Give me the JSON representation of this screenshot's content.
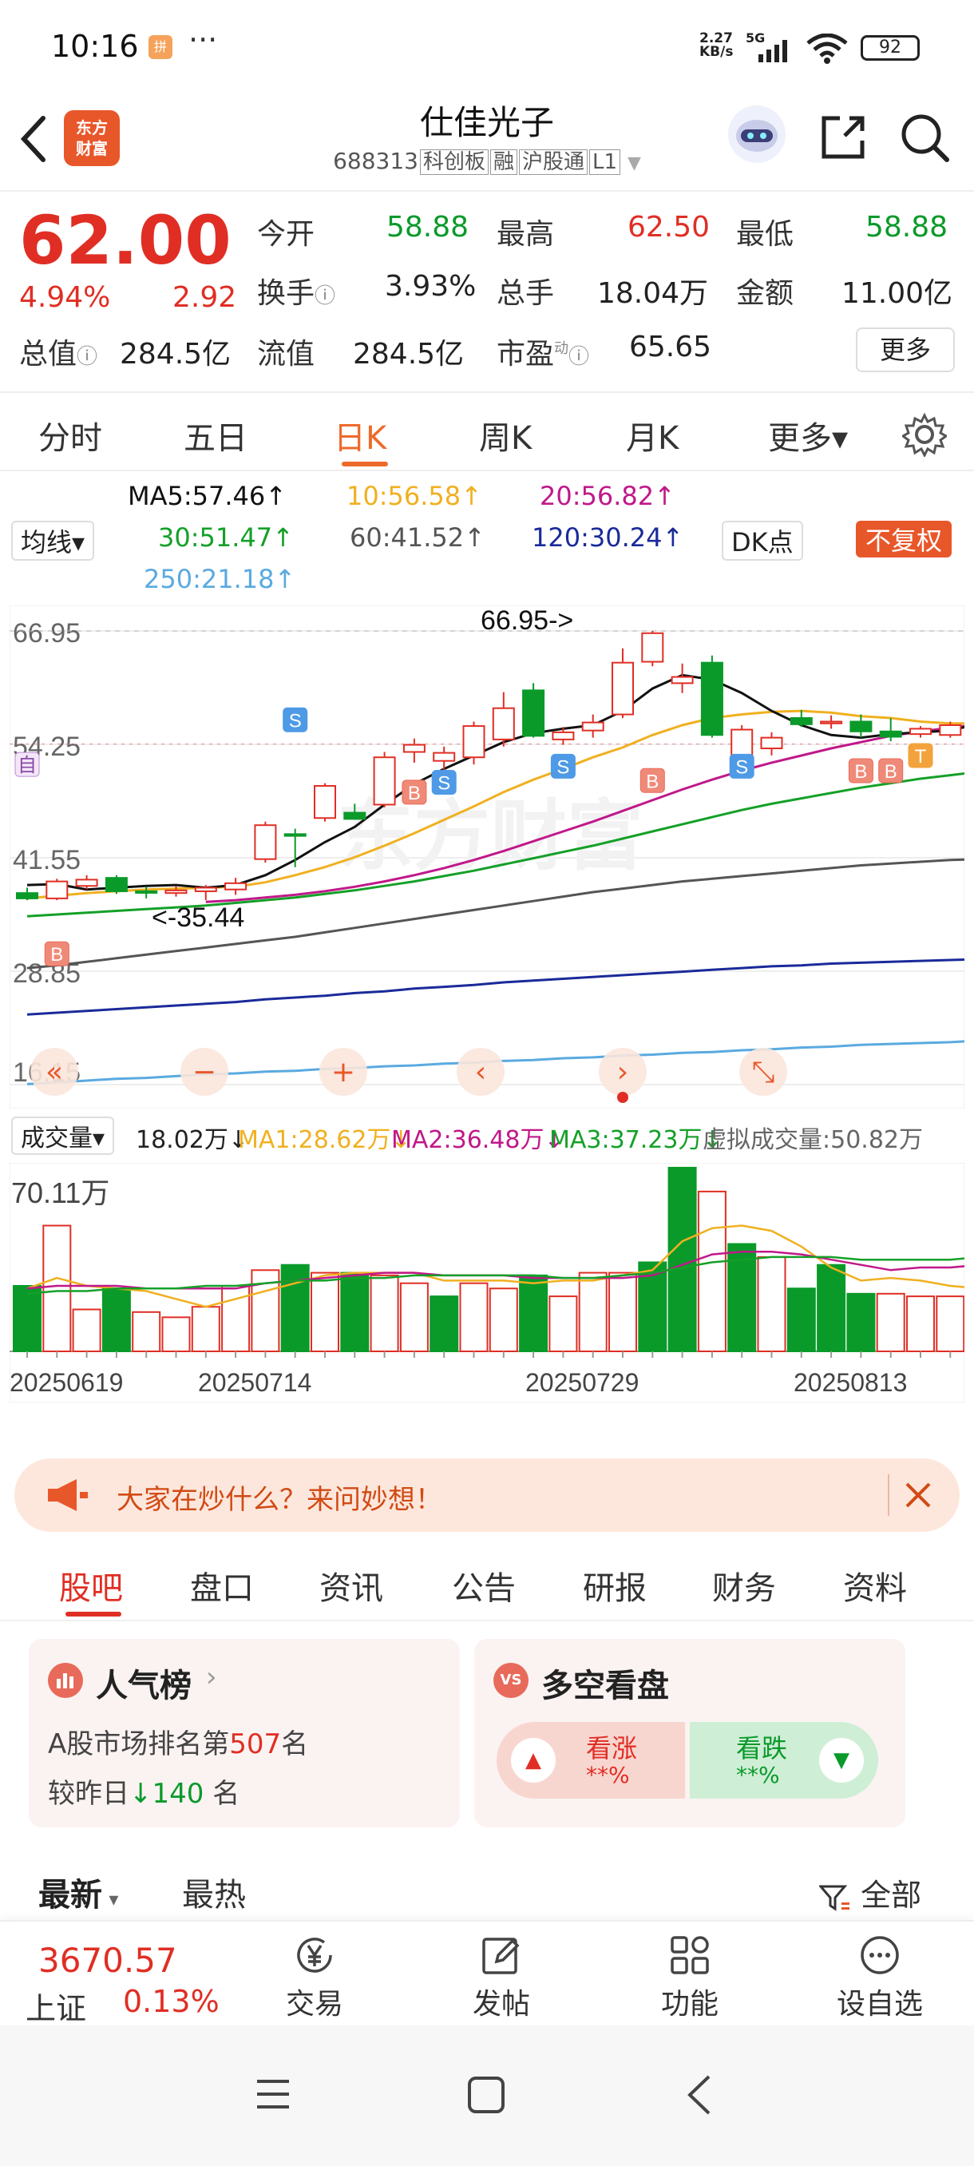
{
  "status_bar": {
    "time": "10:16",
    "notification_badge": "拼",
    "more_dots": "···",
    "net_speed": "2.27",
    "net_unit": "KB/s",
    "signal": "5G",
    "battery": "92"
  },
  "header": {
    "logo_text": "东方财富",
    "stock_name": "仕佳光子",
    "stock_code": "688313",
    "tags": [
      "科创板",
      "融",
      "沪股通",
      "L1"
    ]
  },
  "quote": {
    "price": "62.00",
    "change_pct": "4.94%",
    "change_amt": "2.92",
    "open_label": "今开",
    "open": "58.88",
    "high_label": "最高",
    "high": "62.50",
    "low_label": "最低",
    "low": "58.88",
    "turnover_label": "换手",
    "turnover": "3.93%",
    "volume_label": "总手",
    "volume": "18.04万",
    "amount_label": "金额",
    "amount": "11.00亿",
    "total_cap_label": "总值",
    "total_cap": "284.5亿",
    "float_cap_label": "流值",
    "float_cap": "284.5亿",
    "pe_label": "市盈",
    "pe_sup": "动",
    "pe": "65.65",
    "more_label": "更多"
  },
  "period_tabs": {
    "items": [
      "分时",
      "五日",
      "日K",
      "周K",
      "月K",
      "更多▾"
    ],
    "active": "日K"
  },
  "ma_legend": {
    "ma5": "MA5:57.46↑",
    "ma10": "10:56.58↑",
    "ma20": "20:56.82↑",
    "ma30": "30:51.47↑",
    "ma60": "60:41.52↑",
    "ma120": "120:30.24↑",
    "ma250": "250:21.18↑",
    "selector": "均线▾",
    "dk_label": "DK点",
    "rights_label": "不复权",
    "colors": {
      "ma5": "#111111",
      "ma10": "#f0b020",
      "ma20": "#c0188a",
      "ma30": "#14a028",
      "ma60": "#555555",
      "ma120": "#1a2a9a",
      "ma250": "#5aaae0"
    }
  },
  "kline": {
    "y_ticks": [
      "66.95",
      "54.25",
      "41.55",
      "28.85",
      "16.15"
    ],
    "ymax": 66.95,
    "ymin": 16.15,
    "max_annotation": "66.95->",
    "min_annotation": "<-35.44",
    "ref_price": 59.08,
    "watermark": "东方财富",
    "up_color": "#e02e24",
    "down_color": "#0a9a2a",
    "candles": [
      [
        37.6,
        38.2,
        36.8,
        37.0
      ],
      [
        37.0,
        39.2,
        36.8,
        38.9
      ],
      [
        38.4,
        39.6,
        38.0,
        39.1
      ],
      [
        39.3,
        39.6,
        37.5,
        37.8
      ],
      [
        37.8,
        38.3,
        37.0,
        37.7
      ],
      [
        37.6,
        38.4,
        37.2,
        37.9
      ],
      [
        37.8,
        38.5,
        36.8,
        38.2
      ],
      [
        38.0,
        39.3,
        37.4,
        38.7
      ],
      [
        41.4,
        45.6,
        41.0,
        45.2
      ],
      [
        44.2,
        44.8,
        40.5,
        44.0
      ],
      [
        46.0,
        49.9,
        45.6,
        49.6
      ],
      [
        46.6,
        47.6,
        45.8,
        45.9
      ],
      [
        47.5,
        53.4,
        47.2,
        52.8
      ],
      [
        53.4,
        54.9,
        52.2,
        54.2
      ],
      [
        52.4,
        54.0,
        51.4,
        53.3
      ],
      [
        52.8,
        56.8,
        52.0,
        56.3
      ],
      [
        54.8,
        60.1,
        54.0,
        58.3
      ],
      [
        60.3,
        61.1,
        55.0,
        55.2
      ],
      [
        54.8,
        56.2,
        54.2,
        55.6
      ],
      [
        55.8,
        57.6,
        55.0,
        56.7
      ],
      [
        57.6,
        65.0,
        57.2,
        63.4
      ],
      [
        63.5,
        66.95,
        63.0,
        66.7
      ],
      [
        61.1,
        63.3,
        60.0,
        61.8
      ],
      [
        63.4,
        64.2,
        55.0,
        55.3
      ],
      [
        52.8,
        56.4,
        52.0,
        55.9
      ],
      [
        53.8,
        55.6,
        53.0,
        55.0
      ],
      [
        57.2,
        58.1,
        56.2,
        56.5
      ],
      [
        56.6,
        57.5,
        56.0,
        56.8
      ],
      [
        56.8,
        57.6,
        55.0,
        55.7
      ],
      [
        55.7,
        57.2,
        54.6,
        55.1
      ],
      [
        55.4,
        56.3,
        55.0,
        56.0
      ],
      [
        55.3,
        56.8,
        55.0,
        56.4
      ],
      [
        57.6,
        60.8,
        57.0,
        56.3
      ],
      [
        58.9,
        62.5,
        58.88,
        62.0
      ]
    ],
    "ma_series": {
      "ma5": [
        38.5,
        38.6,
        38.0,
        38.2,
        38.4,
        38.5,
        38.2,
        38.5,
        39.6,
        41.3,
        43.3,
        45.0,
        47.5,
        49.8,
        51.5,
        53.0,
        54.5,
        55.5,
        56.0,
        56.4,
        58.0,
        60.5,
        62.0,
        61.5,
        60.0,
        58.0,
        56.4,
        55.3,
        55.0,
        55.4,
        55.6,
        55.8,
        56.6,
        57.46
      ],
      "ma10": [
        37.0,
        37.3,
        37.6,
        37.8,
        38.0,
        38.1,
        38.2,
        38.3,
        38.8,
        39.6,
        40.5,
        41.6,
        42.9,
        44.3,
        45.8,
        47.3,
        48.9,
        50.3,
        51.5,
        52.8,
        53.9,
        55.3,
        56.4,
        57.2,
        57.6,
        57.9,
        58.0,
        57.8,
        57.4,
        57.2,
        56.8,
        56.6,
        56.6,
        56.58
      ],
      "ma20": [
        null,
        null,
        null,
        null,
        null,
        null,
        36.6,
        36.8,
        37.1,
        37.4,
        37.8,
        38.3,
        38.9,
        39.6,
        40.4,
        41.3,
        42.3,
        43.4,
        44.5,
        45.6,
        46.8,
        48.0,
        49.2,
        50.3,
        51.3,
        52.2,
        53.0,
        53.8,
        54.5,
        55.2,
        55.7,
        56.1,
        56.5,
        56.82
      ],
      "ma30": [
        35.0,
        35.2,
        35.4,
        35.6,
        35.8,
        36.0,
        36.2,
        36.5,
        36.8,
        37.1,
        37.5,
        37.9,
        38.4,
        38.9,
        39.5,
        40.1,
        40.8,
        41.5,
        42.2,
        42.9,
        43.7,
        44.5,
        45.3,
        46.1,
        46.9,
        47.6,
        48.2,
        48.8,
        49.4,
        49.9,
        50.4,
        50.8,
        51.2,
        51.47
      ],
      "ma60": [
        29.2,
        29.5,
        29.9,
        30.3,
        30.7,
        31.1,
        31.5,
        31.9,
        32.3,
        32.7,
        33.2,
        33.7,
        34.2,
        34.7,
        35.2,
        35.7,
        36.2,
        36.7,
        37.2,
        37.7,
        38.1,
        38.5,
        38.9,
        39.2,
        39.5,
        39.8,
        40.1,
        40.4,
        40.7,
        40.9,
        41.1,
        41.3,
        41.4,
        41.52
      ],
      "ma120": [
        24.0,
        24.2,
        24.4,
        24.6,
        24.8,
        25.0,
        25.2,
        25.4,
        25.7,
        25.9,
        26.1,
        26.4,
        26.6,
        26.9,
        27.1,
        27.3,
        27.6,
        27.8,
        28.0,
        28.2,
        28.4,
        28.6,
        28.8,
        29.0,
        29.2,
        29.4,
        29.5,
        29.7,
        29.8,
        29.9,
        30.0,
        30.1,
        30.2,
        30.24
      ],
      "ma250": [
        16.2,
        16.4,
        16.6,
        16.8,
        16.9,
        17.1,
        17.3,
        17.4,
        17.6,
        17.7,
        17.9,
        18.0,
        18.2,
        18.3,
        18.5,
        18.6,
        18.8,
        18.9,
        19.1,
        19.2,
        19.4,
        19.5,
        19.7,
        19.8,
        20.0,
        20.1,
        20.3,
        20.4,
        20.6,
        20.7,
        20.8,
        20.9,
        21.1,
        21.18
      ]
    },
    "markers": [
      {
        "i": 1,
        "type": "B",
        "price": 30.8
      },
      {
        "i": 9,
        "type": "S",
        "price": 57.0
      },
      {
        "i": 13,
        "type": "B",
        "price": 48.9
      },
      {
        "i": 14,
        "type": "S",
        "price": 50.0
      },
      {
        "i": 18,
        "type": "S",
        "price": 51.8
      },
      {
        "i": 21,
        "type": "B",
        "price": 50.2
      },
      {
        "i": 24,
        "type": "S",
        "price": 51.8
      },
      {
        "i": 28,
        "type": "B",
        "price": 51.3
      },
      {
        "i": 29,
        "type": "B",
        "price": 51.3
      },
      {
        "i": 30,
        "type": "T",
        "price": 53.0
      },
      {
        "i": 0,
        "type": "自",
        "price": 52.0
      }
    ],
    "controls": [
      "«",
      "−",
      "+",
      "‹",
      "›",
      "⤡"
    ]
  },
  "volume": {
    "selector": "成交量▾",
    "current": "18.02万↓",
    "ma1": "MA1:28.62万↓",
    "ma2": "MA2:36.48万↓",
    "ma3": "MA3:37.23万↓",
    "virtual": "虚拟成交量:50.82万",
    "ytick": "70.11万",
    "ymax": 70.11,
    "dates": [
      "20250619",
      "20250714",
      "20250729",
      "20250813"
    ],
    "bars": [
      25,
      48,
      16,
      24,
      15,
      13,
      17,
      25,
      31,
      33,
      30,
      30,
      29,
      26,
      21,
      26,
      24,
      29,
      21,
      30,
      30,
      34,
      70.11,
      61,
      41,
      36,
      24,
      33,
      22,
      22,
      21,
      21,
      24,
      37
    ],
    "bar_up": [
      false,
      true,
      true,
      false,
      true,
      true,
      true,
      true,
      true,
      false,
      true,
      false,
      true,
      true,
      false,
      true,
      true,
      false,
      true,
      true,
      true,
      false,
      false,
      true,
      false,
      true,
      false,
      false,
      false,
      true,
      true,
      true,
      true,
      true
    ],
    "ma1_line": [
      24,
      28,
      25,
      24,
      23,
      20,
      17,
      20,
      23,
      26,
      29,
      30,
      30,
      30,
      27,
      27,
      27,
      26,
      27,
      27,
      29,
      31,
      42,
      47,
      48,
      46,
      40,
      32,
      27,
      28,
      27,
      25,
      24,
      28.62
    ],
    "ma2_line": [
      24,
      25,
      25,
      25,
      24,
      24,
      24,
      24,
      26,
      27,
      28,
      29,
      30,
      30,
      29,
      29,
      29,
      28,
      28,
      28,
      28,
      29,
      33,
      37,
      38,
      38,
      37,
      35,
      33,
      31,
      32,
      32,
      33,
      36.48
    ],
    "ma3_line": [
      22,
      23,
      23,
      24,
      24,
      24,
      25,
      25,
      26,
      27,
      27,
      28,
      28,
      29,
      29,
      29,
      29,
      29,
      28,
      28,
      29,
      30,
      32,
      34,
      35,
      36,
      36,
      36,
      35,
      35,
      35,
      35,
      36,
      37.23
    ]
  },
  "banner": {
    "text": "大家在炒什么？来问妙想！"
  },
  "section_tabs": {
    "items": [
      "股吧",
      "盘口",
      "资讯",
      "公告",
      "研报",
      "财务",
      "资料"
    ],
    "active": "股吧"
  },
  "popularity_card": {
    "title": "人气榜",
    "rank_prefix": "A股市场排名第",
    "rank": "507",
    "rank_suffix": "名",
    "change_prefix": "较昨日",
    "change_arrow": "↓",
    "change": "140",
    "change_suffix": "名"
  },
  "sentiment_card": {
    "badge": "VS",
    "title": "多空看盘",
    "bull_label": "看涨",
    "bull_value": "**%",
    "bear_label": "看跌",
    "bear_value": "**%"
  },
  "sort_bar": {
    "latest": "最新",
    "hottest": "最热",
    "filter": "全部"
  },
  "bottom_bar": {
    "index_value": "3670.57",
    "index_name": "上证",
    "index_change": "0.13%",
    "buttons": [
      "交易",
      "发帖",
      "功能",
      "设自选"
    ]
  }
}
